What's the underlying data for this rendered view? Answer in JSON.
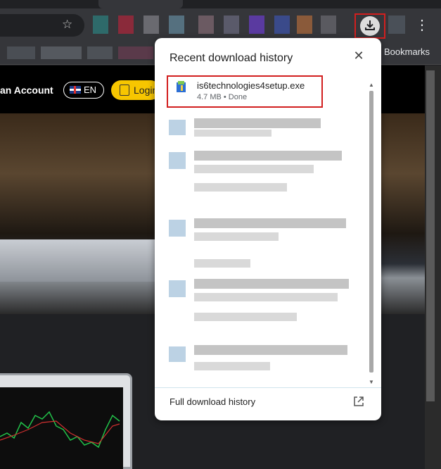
{
  "browser": {
    "star_icon": "star-icon",
    "download_icon": "download-icon",
    "menu_icon": "more-vert-icon",
    "bookmarks_label": "Bookmarks"
  },
  "site": {
    "account_link": "an Account",
    "language": "EN",
    "login_label": "Login"
  },
  "downloads": {
    "title": "Recent download history",
    "items": [
      {
        "name": "is6technologies4setup.exe",
        "size": "4.7 MB",
        "status": "Done",
        "status_line": "4.7 MB • Done"
      }
    ],
    "footer_label": "Full download history"
  },
  "colors": {
    "highlight": "#d21f1f",
    "login_button": "#f7c600",
    "bubble_bg": "#ffffff"
  }
}
